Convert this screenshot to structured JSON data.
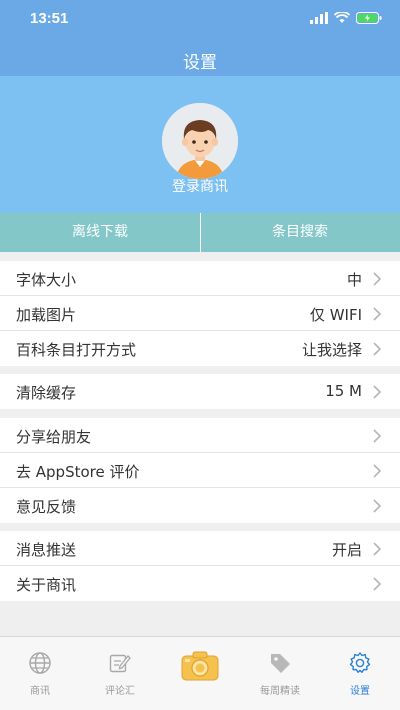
{
  "status": {
    "time": "13:51"
  },
  "nav": {
    "title": "设置"
  },
  "profile": {
    "login_label": "登录商讯"
  },
  "actions": {
    "offline_download": "离线下载",
    "entry_search": "条目搜索"
  },
  "groups": [
    {
      "rows": [
        {
          "label": "字体大小",
          "value": "中"
        },
        {
          "label": "加载图片",
          "value": "仅 WIFI"
        },
        {
          "label": "百科条目打开方式",
          "value": "让我选择"
        }
      ]
    },
    {
      "rows": [
        {
          "label": "清除缓存",
          "value": "15 M"
        }
      ]
    },
    {
      "rows": [
        {
          "label": "分享给朋友",
          "value": ""
        },
        {
          "label": "去 AppStore 评价",
          "value": ""
        },
        {
          "label": "意见反馈",
          "value": ""
        }
      ]
    },
    {
      "rows": [
        {
          "label": "消息推送",
          "value": "开启"
        },
        {
          "label": "关于商讯",
          "value": ""
        }
      ]
    }
  ],
  "tabs": [
    {
      "label": "商讯",
      "icon": "globe-icon"
    },
    {
      "label": "评论汇",
      "icon": "pen-paper-icon"
    },
    {
      "label": "",
      "icon": "camera-icon"
    },
    {
      "label": "每周精读",
      "icon": "tag-icon"
    },
    {
      "label": "设置",
      "icon": "gear-icon",
      "active": true
    }
  ],
  "colors": {
    "header": "#6aa9e6",
    "profile_bg": "#7dc0f2",
    "action_bg": "#83c7c9",
    "active_tab": "#2a7fd5",
    "camera": "#f5c14f"
  }
}
